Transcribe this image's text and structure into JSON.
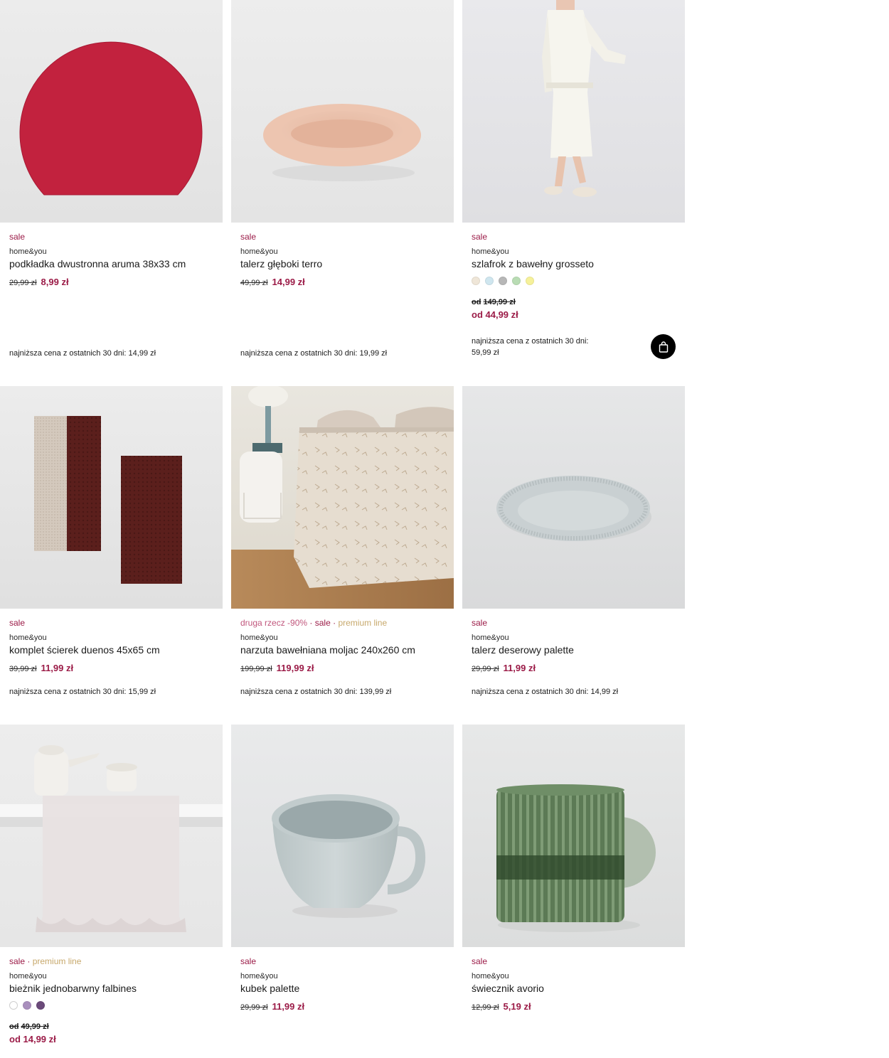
{
  "products": [
    {
      "tags": [
        "sale"
      ],
      "brand": "home&you",
      "name": "podkładka dwustronna aruma 38x33 cm",
      "old_price": "29,99 zł",
      "new_price": "8,99 zł",
      "lowest_price": "najniższa cena z ostatnich 30 dni: 14,99 zł"
    },
    {
      "tags": [
        "sale"
      ],
      "brand": "home&you",
      "name": "talerz głęboki terro",
      "old_price": "49,99 zł",
      "new_price": "14,99 zł",
      "lowest_price": "najniższa cena z ostatnich 30 dni: 19,99 zł"
    },
    {
      "tags": [
        "sale"
      ],
      "brand": "home&you",
      "name": "szlafrok z bawełny grosseto",
      "swatches": [
        "#efe6d8",
        "#cfe6ef",
        "#b7b7b7",
        "#b9dcb4",
        "#f6f19a"
      ],
      "from_label": "od",
      "old_price": "149,99 zł",
      "new_price": "od 44,99 zł",
      "lowest_price_line1": "najniższa cena z ostatnich 30 dni:",
      "lowest_price_line2": "59,99 zł",
      "cart_icon": "shopping-bag-icon"
    },
    {
      "tags": [
        "sale"
      ],
      "brand": "home&you",
      "name": "komplet ścierek duenos 45x65 cm",
      "old_price": "39,99 zł",
      "new_price": "11,99 zł",
      "lowest_price": "najniższa cena z ostatnich 30 dni: 15,99 zł"
    },
    {
      "tags": [
        "druga rzecz -90%",
        "sale",
        "premium line"
      ],
      "brand": "home&you",
      "name": "narzuta bawełniana moljac 240x260 cm",
      "old_price": "199,99 zł",
      "new_price": "119,99 zł",
      "lowest_price": "najniższa cena z ostatnich 30 dni: 139,99 zł"
    },
    {
      "tags": [
        "sale"
      ],
      "brand": "home&you",
      "name": "talerz deserowy palette",
      "old_price": "29,99 zł",
      "new_price": "11,99 zł",
      "lowest_price": "najniższa cena z ostatnich 30 dni: 14,99 zł"
    },
    {
      "tags": [
        "sale",
        "premium line"
      ],
      "brand": "home&you",
      "name": "bieżnik jednobarwny falbines",
      "swatches": [
        "#ffffff",
        "#a98fbd",
        "#6b4a7a"
      ],
      "from_label": "od",
      "old_price": "49,99 zł",
      "new_price": "od 14,99 zł"
    },
    {
      "tags": [
        "sale"
      ],
      "brand": "home&you",
      "name": "kubek palette",
      "old_price": "29,99 zł",
      "new_price": "11,99 zł"
    },
    {
      "tags": [
        "sale"
      ],
      "brand": "home&you",
      "name": "świecznik avorio",
      "old_price": "12,99 zł",
      "new_price": "5,19 zł"
    }
  ],
  "colors": {
    "sale": "#9b1b47",
    "promo": "#c0567c",
    "premium": "#c7a86b",
    "price": "#9b1b47"
  }
}
